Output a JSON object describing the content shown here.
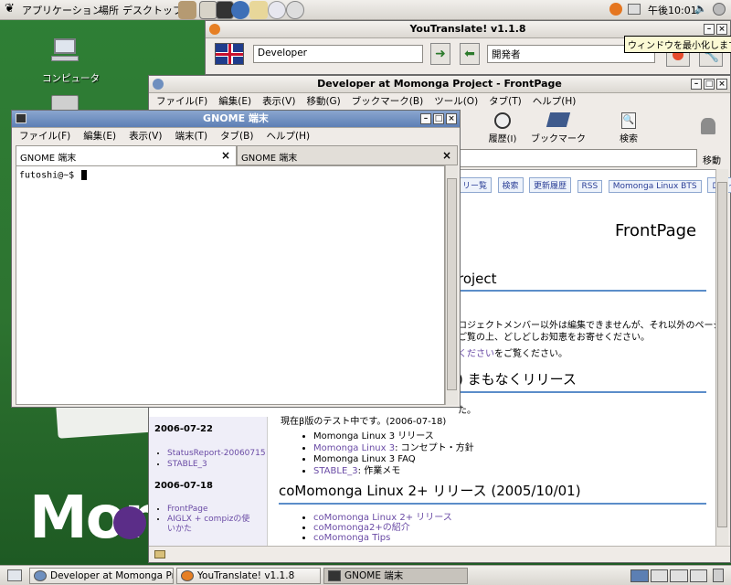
{
  "top_panel": {
    "applications": "アプリケーション",
    "places": "場所",
    "desktop": "デスクトップ",
    "clock": "午後10:01",
    "launchers": [
      "gimp-icon",
      "mail-icon",
      "terminal-icon",
      "globe-icon",
      "editor-icon",
      "cd-icon",
      "kde-icon"
    ]
  },
  "desktop": {
    "computer_label": "コンピュータ",
    "logo_text": "Mon"
  },
  "youtranslate": {
    "title": "YouTranslate! v1.1.8",
    "source": "Developer",
    "target": "開発者",
    "tooltip": "ウィンドウを最小化します"
  },
  "browser": {
    "title": "Developer at Momonga Project - FrontPage",
    "menu": [
      "ファイル(F)",
      "編集(E)",
      "表示(V)",
      "移動(G)",
      "ブックマーク(B)",
      "ツール(O)",
      "タブ(T)",
      "ヘルプ(H)"
    ],
    "toolbar": {
      "history": "履歴(I)",
      "bookmarks": "ブックマーク",
      "search": "検索"
    },
    "go_label": "移動",
    "nav_links": [
      "リー覧",
      "検索",
      "更新履歴",
      "RSS",
      "Momonga Linux BTS",
      "ログイン"
    ],
    "page_title": "FrontPage",
    "heading1": "roject",
    "para1": "ロジェクトメンバー以外は編集できませんが、それ以外のページ",
    "para2": "ご覧の上、どしどしお知恵をお寄せください。",
    "para3_link": "ください",
    "para3_text": "をご覧ください。",
    "heading2": ") まもなくリリース",
    "small_text": "た。",
    "beta_text": "現在β版のテスト中です。(2006-07-18)",
    "list1": [
      {
        "link": "",
        "text": "Momonga Linux 3 リリース"
      },
      {
        "link": "Momonga Linux 3",
        "text": ": コンセプト・方針"
      },
      {
        "link": "",
        "text": "Momonga Linux 3 FAQ"
      },
      {
        "link": "STABLE_3",
        "text": ": 作業メモ"
      }
    ],
    "heading3": "coMomonga Linux 2+ リリース (2005/10/01)",
    "list2": [
      "coMomonga Linux 2+ リリース",
      "coMomonga2+の紹介",
      "coMomonga Tips"
    ],
    "sidebar": {
      "date1": "2006-07-22",
      "items1": [
        "StatusReport-20060715",
        "STABLE_3"
      ],
      "date2": "2006-07-18",
      "items2": [
        "FrontPage",
        "AIGLX + compizの使",
        "いかた"
      ]
    }
  },
  "terminal": {
    "title": "GNOME 端末",
    "menu": [
      "ファイル(F)",
      "編集(E)",
      "表示(V)",
      "端末(T)",
      "タブ(B)",
      "ヘルプ(H)"
    ],
    "tabs": [
      "GNOME 端末",
      "GNOME 端末"
    ],
    "prompt": "futoshi@~$"
  },
  "taskbar": {
    "items": [
      "Developer at Momonga Proj…",
      "YouTranslate! v1.1.8",
      "GNOME 端末"
    ]
  },
  "colors": {
    "desktop": "#2f7a34",
    "link": "#6a4ba5",
    "heading_rule": "#5b8dc9"
  }
}
